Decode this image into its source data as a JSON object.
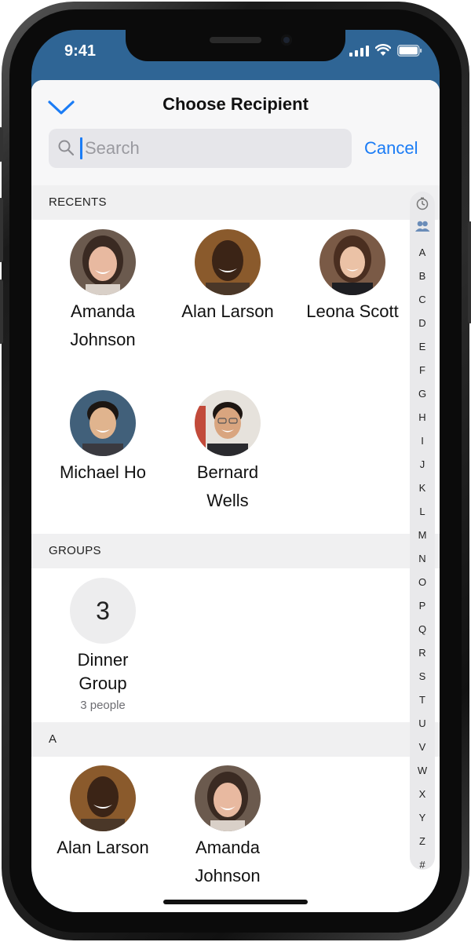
{
  "status": {
    "time": "9:41"
  },
  "header": {
    "title": "Choose Recipient",
    "cancel_label": "Cancel"
  },
  "search": {
    "placeholder": "Search",
    "value": ""
  },
  "sections": {
    "recents": "RECENTS",
    "groups": "GROUPS",
    "a": "A"
  },
  "recents": [
    {
      "name": "Amanda Johnson",
      "line1": "Amanda",
      "line2": "Johnson"
    },
    {
      "name": "Alan Larson",
      "line1": "Alan Larson",
      "line2": ""
    },
    {
      "name": "Leona Scott",
      "line1": "Leona Scott",
      "line2": ""
    },
    {
      "name": "Michael Ho",
      "line1": "Michael Ho",
      "line2": ""
    },
    {
      "name": "Bernard Wells",
      "line1": "Bernard",
      "line2": "Wells"
    }
  ],
  "groups": [
    {
      "count": "3",
      "line1": "Dinner",
      "line2": "Group",
      "subtitle": "3 people"
    }
  ],
  "a_contacts": [
    {
      "name": "Alan Larson",
      "line1": "Alan Larson",
      "line2": ""
    },
    {
      "name": "Amanda Johnson",
      "line1": "Amanda",
      "line2": "Johnson"
    }
  ],
  "index": [
    "A",
    "B",
    "C",
    "D",
    "E",
    "F",
    "G",
    "H",
    "I",
    "J",
    "K",
    "L",
    "M",
    "N",
    "O",
    "P",
    "Q",
    "R",
    "S",
    "T",
    "U",
    "V",
    "W",
    "X",
    "Y",
    "Z",
    "#"
  ],
  "colors": {
    "accent": "#1b7cf5",
    "statusbar": "#2f6595"
  }
}
